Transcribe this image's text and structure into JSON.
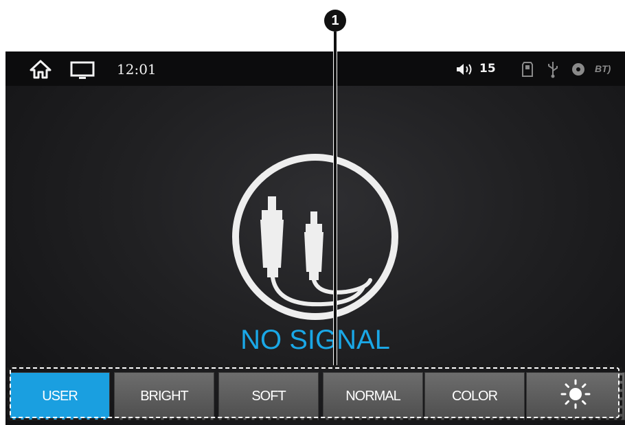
{
  "callout": {
    "number": "1"
  },
  "status_bar": {
    "time": "12:01",
    "volume": "15",
    "bt_label": "BT",
    "icons": [
      "home-icon",
      "tv-icon",
      "volume-icon",
      "sd-card-icon",
      "usb-icon",
      "disc-icon",
      "bluetooth-icon"
    ]
  },
  "main": {
    "message": "NO SIGNAL",
    "icon": "rca-cable-icon"
  },
  "mode_bar": {
    "buttons": [
      {
        "label": "USER",
        "active": true
      },
      {
        "label": "BRIGHT",
        "active": false
      },
      {
        "label": "SOFT",
        "active": false
      },
      {
        "label": "NORMAL",
        "active": false
      },
      {
        "label": "COLOR",
        "active": false
      },
      {
        "label": "",
        "icon": "brightness-icon",
        "active": false
      }
    ]
  },
  "colors": {
    "accent": "#1aa7e6",
    "active_button": "#1a9fe0",
    "button": "#5e5e5e",
    "status_bar": "#0c0c0d"
  }
}
